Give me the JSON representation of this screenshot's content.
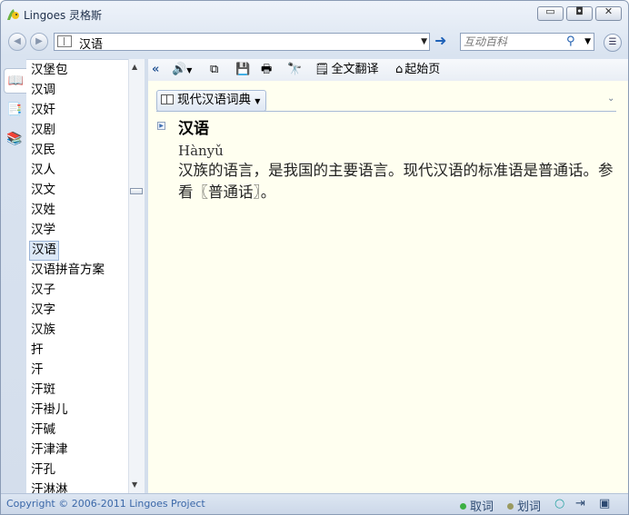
{
  "window": {
    "title": "Lingoes 灵格斯",
    "minimize": "▭",
    "maximize": "◘",
    "close": "✕"
  },
  "address": {
    "value": "汉语",
    "search_placeholder": "互动百科"
  },
  "sidebar_tabs": [
    "dictionary-tab-icon",
    "index-tab-icon",
    "translate-tab-icon"
  ],
  "words": [
    "汉堡包",
    "汉调",
    "汉奸",
    "汉剧",
    "汉民",
    "汉人",
    "汉文",
    "汉姓",
    "汉学",
    "汉语",
    "汉语拼音方案",
    "汉子",
    "汉字",
    "汉族",
    "扞",
    "汗",
    "汗斑",
    "汗褂儿",
    "汗碱",
    "汗津津",
    "汗孔",
    "汗淋淋"
  ],
  "selected_word_index": 9,
  "toolbar": {
    "collapse": "«",
    "full_translate": "全文翻译",
    "home": "起始页"
  },
  "entry": {
    "dictionary": "现代汉语词典",
    "headword": "汉语",
    "pinyin": "Hànyǔ",
    "definition": "汉族的语言，是我国的主要语言。现代汉语的标准语是普通话。参看〖普通话〗。"
  },
  "status": {
    "copyright": "Copyright © 2006-2011 Lingoes Project",
    "lookup": "取词",
    "select": "划词",
    "lookup_color": "#3cb043",
    "select_color": "#9a9a60"
  }
}
